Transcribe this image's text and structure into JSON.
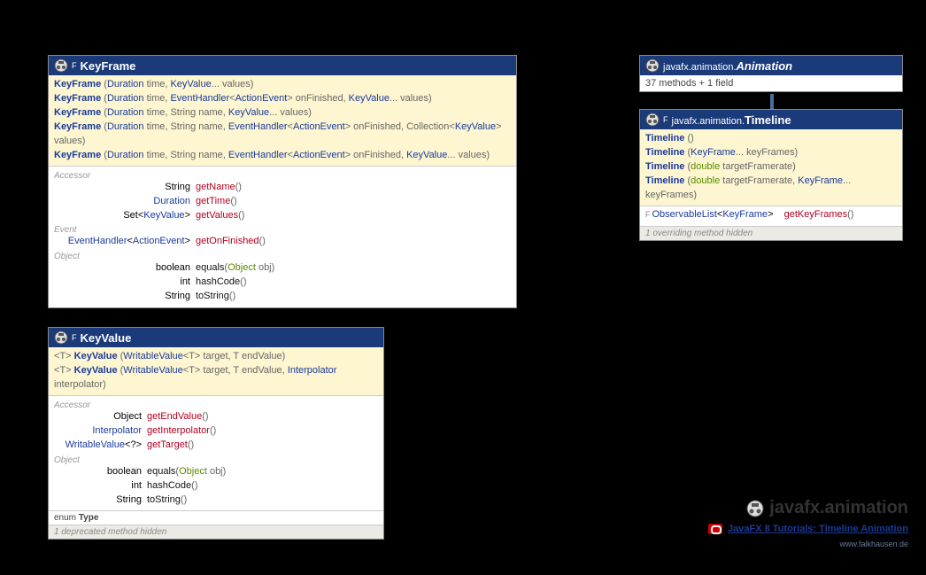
{
  "keyframe": {
    "final_mark": "F",
    "title": "KeyFrame",
    "constructors": [
      {
        "name": "KeyFrame",
        "params": [
          [
            "Duration",
            " time, "
          ],
          [
            "KeyValue",
            "... values"
          ]
        ]
      },
      {
        "name": "KeyFrame",
        "params": [
          [
            "Duration",
            " time, "
          ],
          [
            "EventHandler",
            "<"
          ],
          [
            "ActionEvent",
            "> onFinished, "
          ],
          [
            "KeyValue",
            "... values"
          ]
        ]
      },
      {
        "name": "KeyFrame",
        "params": [
          [
            "Duration",
            " time, String name, "
          ],
          [
            "KeyValue",
            "... values"
          ]
        ]
      },
      {
        "name": "KeyFrame",
        "params": [
          [
            "Duration",
            " time, String name, "
          ],
          [
            "EventHandler",
            "<"
          ],
          [
            "ActionEvent",
            "> onFinished, Collection<"
          ],
          [
            "KeyValue",
            "> values"
          ]
        ]
      },
      {
        "name": "KeyFrame",
        "params": [
          [
            "Duration",
            " time, String name, "
          ],
          [
            "EventHandler",
            "<"
          ],
          [
            "ActionEvent",
            "> onFinished, "
          ],
          [
            "KeyValue",
            "... values"
          ]
        ]
      }
    ],
    "sections": {
      "accessor_label": "Accessor",
      "accessors": [
        {
          "ret": "String",
          "name": "getName",
          "params": "()"
        },
        {
          "ret": "Duration",
          "name": "getTime",
          "params": "()"
        },
        {
          "ret_html": "Set<KeyValue>",
          "name": "getValues",
          "params": "()"
        }
      ],
      "event_label": "Event",
      "event": {
        "ret_html": "EventHandler<ActionEvent>",
        "name": "getOnFinished",
        "params": "()"
      },
      "object_label": "Object",
      "objects": [
        {
          "ret": "boolean",
          "name": "equals",
          "params": "(Object obj)",
          "green_param": true
        },
        {
          "ret": "int",
          "name": "hashCode",
          "params": "()"
        },
        {
          "ret": "String",
          "name": "toString",
          "params": "()"
        }
      ]
    }
  },
  "keyvalue": {
    "final_mark": "F",
    "title": "KeyValue",
    "constructors": [
      {
        "prefix": "<T>",
        "name": "KeyValue",
        "params_html": "(WritableValue<T> target, T endValue)"
      },
      {
        "prefix": "<T>",
        "name": "KeyValue",
        "params_html": "(WritableValue<T> target, T endValue, Interpolator interpolator)"
      }
    ],
    "sections": {
      "accessor_label": "Accessor",
      "accessors": [
        {
          "ret": "Object",
          "name": "getEndValue",
          "params": "()"
        },
        {
          "ret": "Interpolator",
          "name": "getInterpolator",
          "params": "()"
        },
        {
          "ret_html": "WritableValue<?>",
          "name": "getTarget",
          "params": "()"
        }
      ],
      "object_label": "Object",
      "objects": [
        {
          "ret": "boolean",
          "name": "equals",
          "params": "(Object obj)",
          "green_param": true
        },
        {
          "ret": "int",
          "name": "hashCode",
          "params": "()"
        },
        {
          "ret": "String",
          "name": "toString",
          "params": "()"
        }
      ],
      "enum_note": "enum Type",
      "hidden_note": "1 deprecated method hidden"
    }
  },
  "animation": {
    "pkg": "javafx.animation.",
    "title": "Animation",
    "summary": "37 methods + 1 field"
  },
  "timeline": {
    "final_mark": "F",
    "pkg": "javafx.animation.",
    "title": "Timeline",
    "constructors": [
      {
        "name": "Timeline",
        "params_html": "()"
      },
      {
        "name": "Timeline",
        "params_html": "(KeyFrame... keyFrames)"
      },
      {
        "name": "Timeline",
        "params_html": "(double targetFramerate)"
      },
      {
        "name": "Timeline",
        "params_html": "(double targetFramerate, KeyFrame... keyFrames)"
      }
    ],
    "method": {
      "final_mark": "F",
      "ret_html": "ObservableList<KeyFrame>",
      "name": "getKeyFrames",
      "params": "()"
    },
    "hidden_note": "1 overriding method hidden"
  },
  "footer": {
    "title": "javafx.animation",
    "link_text": "JavaFX 8 Tutorials: Timeline Animation",
    "credit": "www.falkhausen.de"
  }
}
